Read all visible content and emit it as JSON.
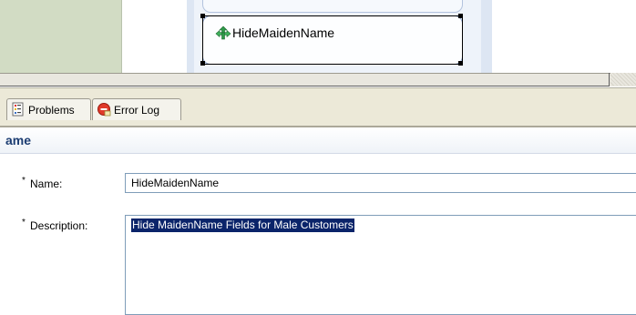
{
  "diagram": {
    "node_label": "HideMaidenName",
    "node_icon": "rule-arrows-icon"
  },
  "views": {
    "tabs": [
      {
        "label": "Problems",
        "icon": "problems-icon"
      },
      {
        "label": "Error Log",
        "icon": "error-log-icon"
      }
    ]
  },
  "properties": {
    "title": "ame",
    "name": {
      "required_mark": "*",
      "label": "Name:",
      "value": "HideMaidenName"
    },
    "description": {
      "required_mark": "*",
      "label": "Description:",
      "value": "Hide MaidenName Fields for Male Customers"
    }
  },
  "colors": {
    "selection": "#0a246a",
    "header_text": "#1c3d72"
  }
}
